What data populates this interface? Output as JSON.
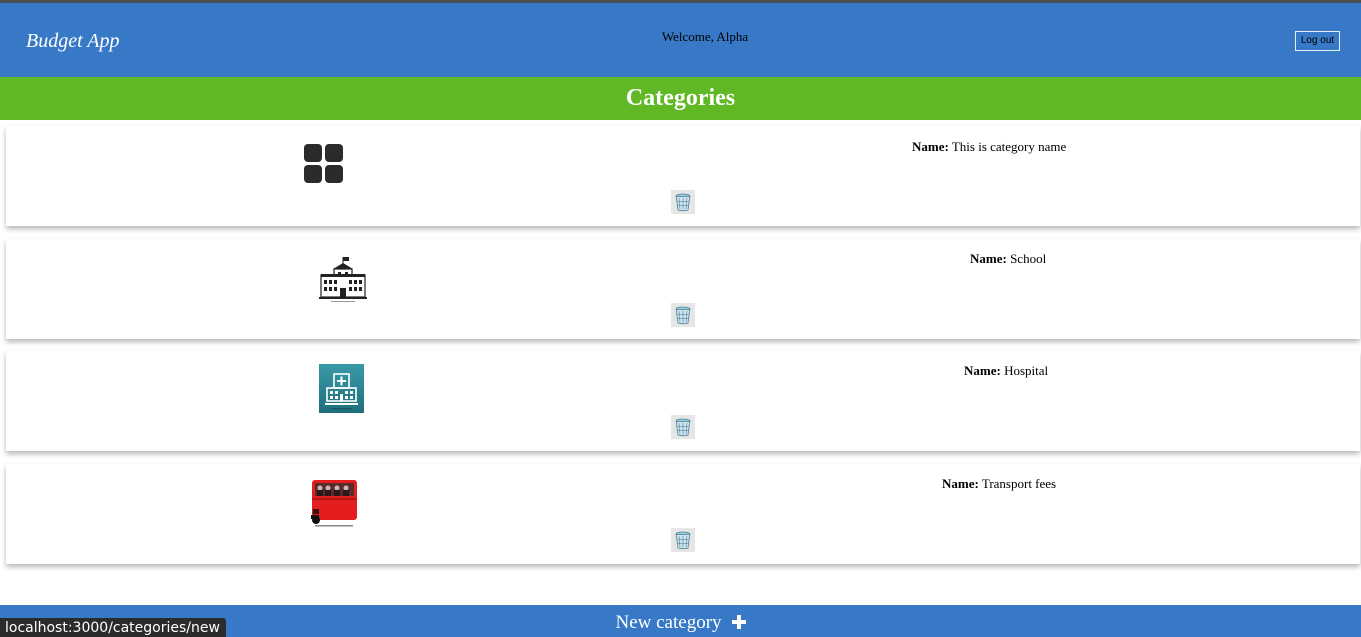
{
  "header": {
    "brand": "Budget App",
    "welcome": "Welcome, Alpha",
    "logout_label": "Log out"
  },
  "page_title": "Categories",
  "name_label": "Name:",
  "categories": [
    {
      "name": "This is category name",
      "icon": "grid-icon"
    },
    {
      "name": "School",
      "icon": "school-building-icon"
    },
    {
      "name": "Hospital",
      "icon": "hospital-icon"
    },
    {
      "name": "Transport fees",
      "icon": "bus-icon"
    }
  ],
  "footer": {
    "new_category_label": "New category",
    "icon": "plus-icon"
  },
  "status_bar": {
    "url": "localhost:3000/categories/new"
  },
  "colors": {
    "header_blue": "#3778c7",
    "title_green": "#5fb824",
    "bus_red": "#e41e1e",
    "hospital_teal": "#2b8a96"
  }
}
